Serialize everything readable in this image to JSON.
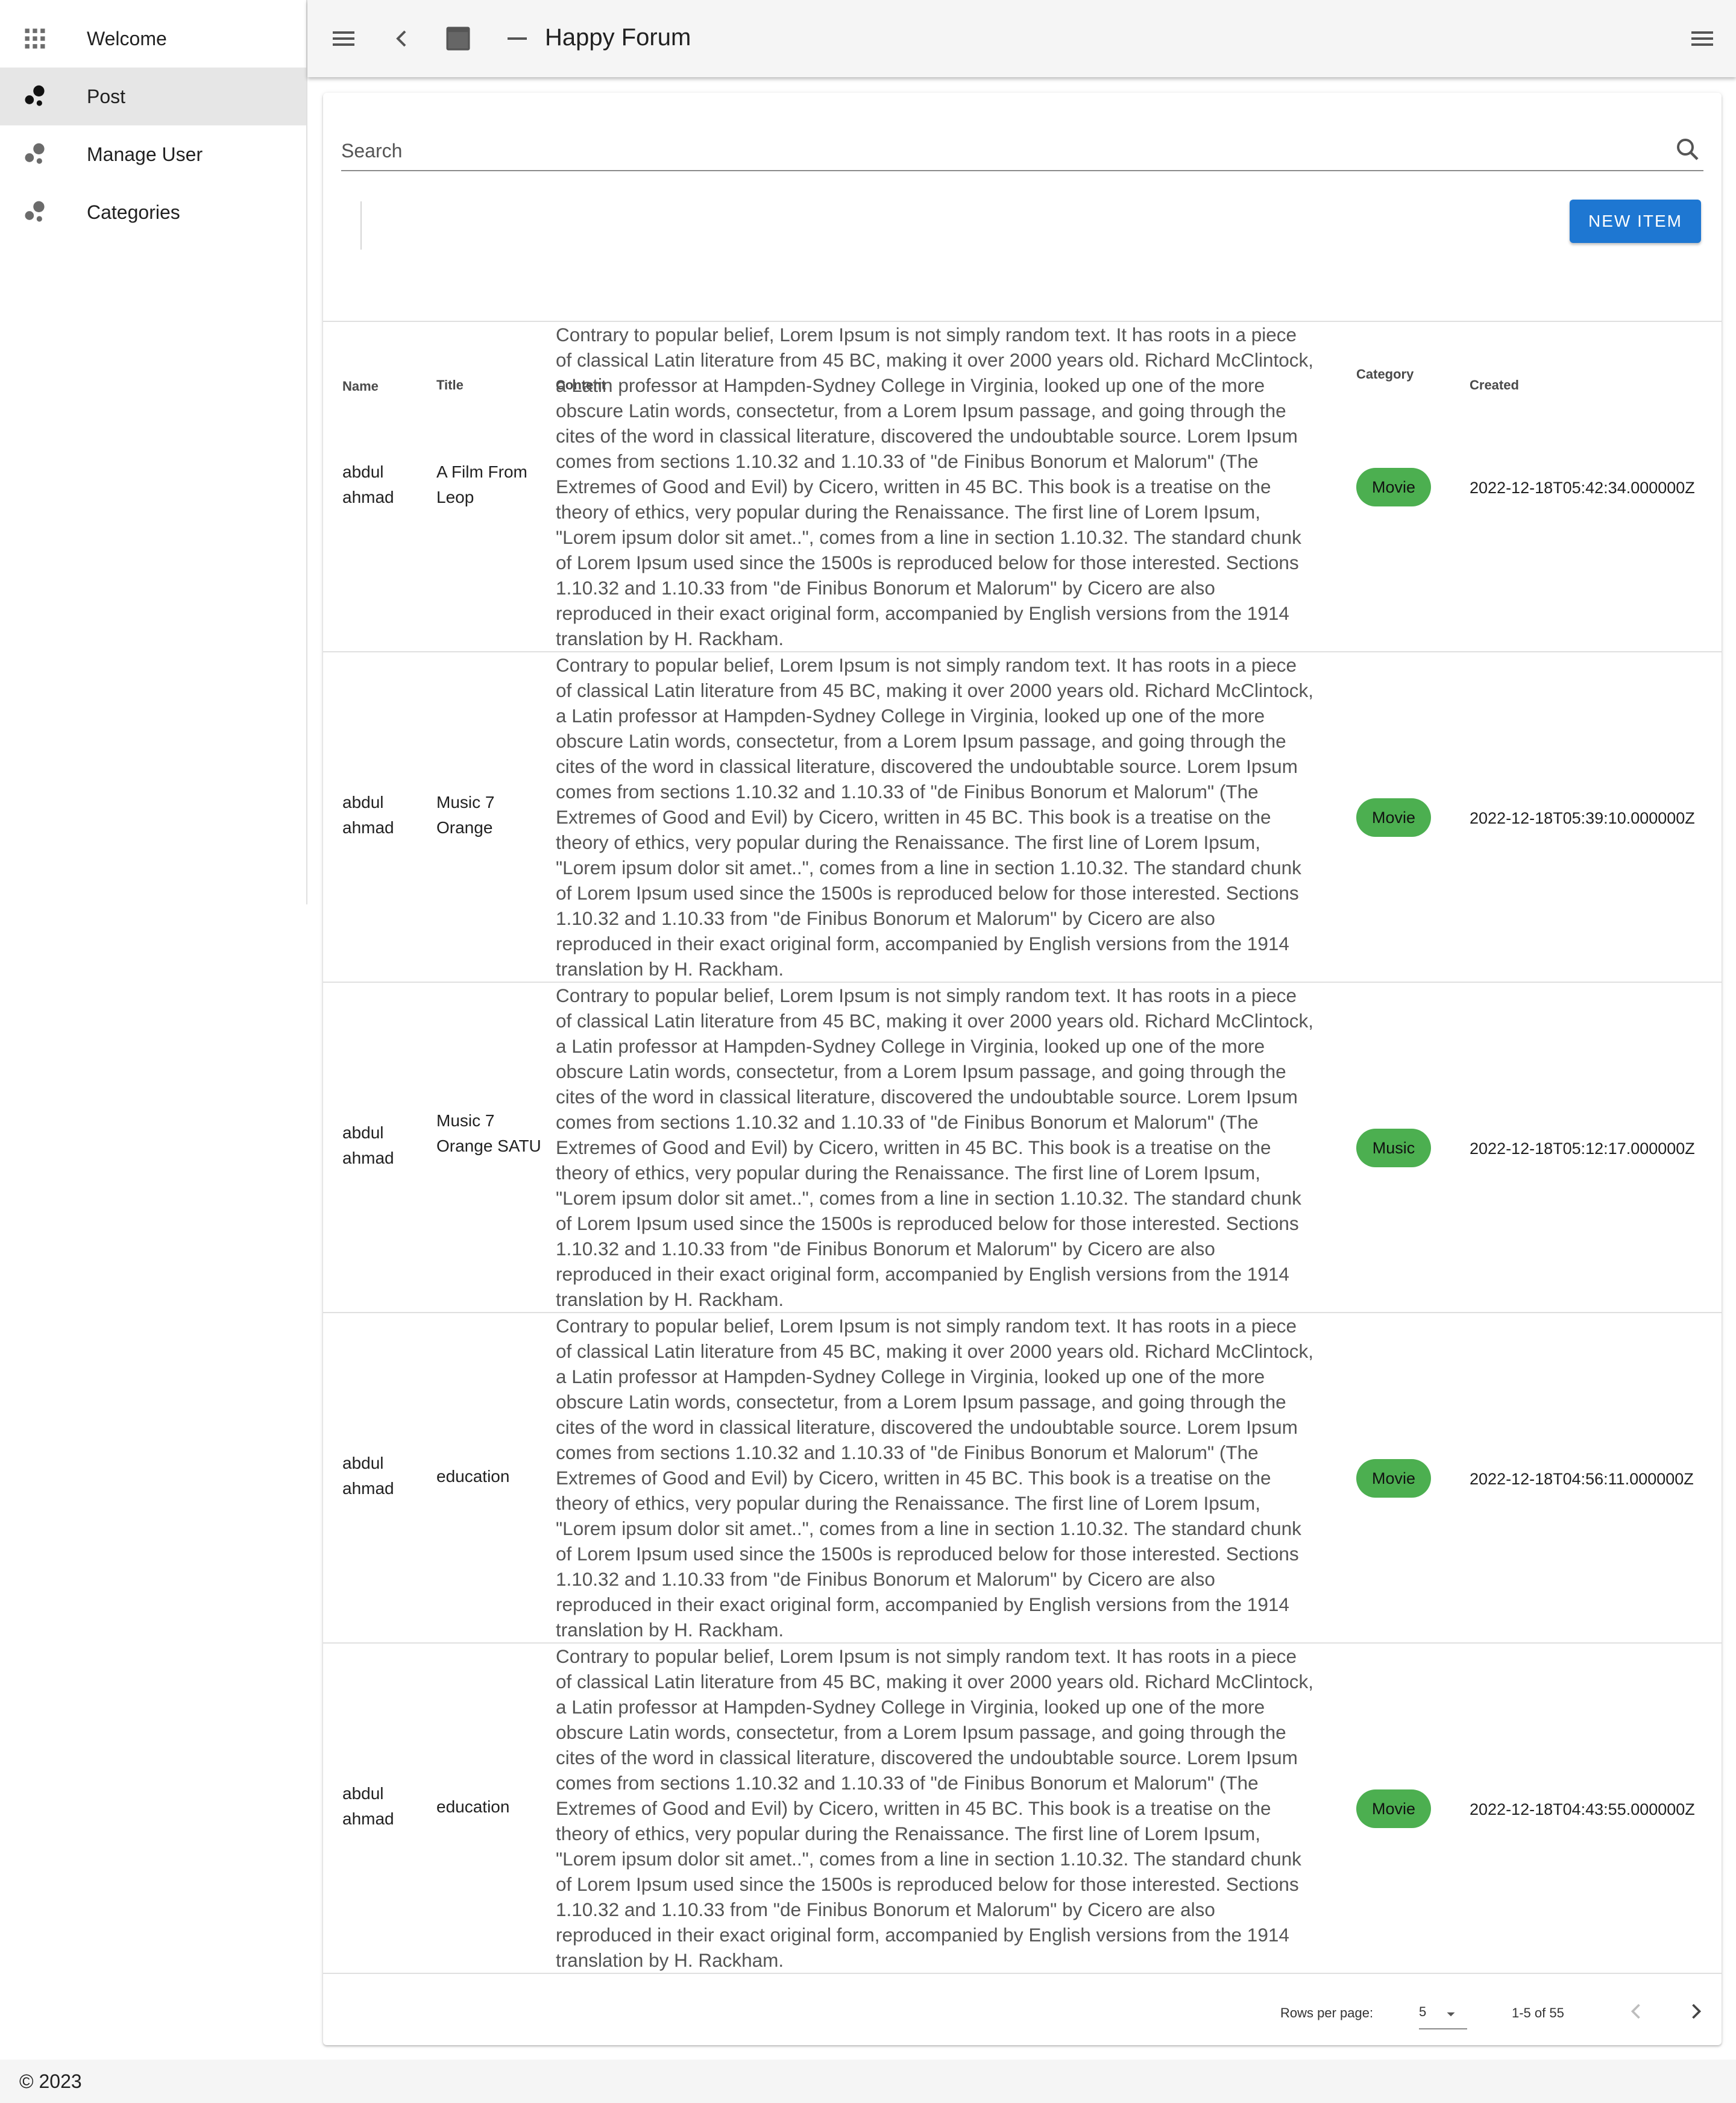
{
  "sidebar": {
    "items": [
      {
        "label": "Welcome",
        "icon": "apps-grid-icon"
      },
      {
        "label": "Post",
        "icon": "bubble-chart-icon"
      },
      {
        "label": "Manage User",
        "icon": "bubble-chart-icon"
      },
      {
        "label": "Categories",
        "icon": "bubble-chart-icon"
      }
    ],
    "active_index": 1
  },
  "header": {
    "title": "Happy Forum",
    "icons": [
      "menu-icon",
      "chevron-left-icon",
      "window-icon",
      "minimize-icon",
      "menu-icon"
    ]
  },
  "search": {
    "placeholder": "Search"
  },
  "toolbar": {
    "new_item_label": "NEW ITEM"
  },
  "table": {
    "columns": [
      "Name",
      "Title",
      "Content",
      "Category",
      "Created"
    ],
    "rows": [
      {
        "name": "abdul ahmad",
        "title": "A Film From Leop",
        "content": "Contrary to popular belief, Lorem Ipsum is not simply random text. It has roots in a piece of classical Latin literature from 45 BC, making it over 2000 years old. Richard McClintock, a Latin professor at Hampden-Sydney College in Virginia, looked up one of the more obscure Latin words, consectetur, from a Lorem Ipsum passage, and going through the cites of the word in classical literature, discovered the undoubtable source. Lorem Ipsum comes from sections 1.10.32 and 1.10.33 of \"de Finibus Bonorum et Malorum\" (The Extremes of Good and Evil) by Cicero, written in 45 BC. This book is a treatise on the theory of ethics, very popular during the Renaissance. The first line of Lorem Ipsum, \"Lorem ipsum dolor sit amet..\", comes from a line in section 1.10.32. The standard chunk of Lorem Ipsum used since the 1500s is reproduced below for those interested. Sections 1.10.32 and 1.10.33 from \"de Finibus Bonorum et Malorum\" by Cicero are also reproduced in their exact original form, accompanied by English versions from the 1914 translation by H. Rackham.",
        "category": "Movie",
        "created": "2022-12-18T05:42:34.000000Z"
      },
      {
        "name": "abdul ahmad",
        "title": "Music 7 Orange",
        "content": "Contrary to popular belief, Lorem Ipsum is not simply random text. It has roots in a piece of classical Latin literature from 45 BC, making it over 2000 years old. Richard McClintock, a Latin professor at Hampden-Sydney College in Virginia, looked up one of the more obscure Latin words, consectetur, from a Lorem Ipsum passage, and going through the cites of the word in classical literature, discovered the undoubtable source. Lorem Ipsum comes from sections 1.10.32 and 1.10.33 of \"de Finibus Bonorum et Malorum\" (The Extremes of Good and Evil) by Cicero, written in 45 BC. This book is a treatise on the theory of ethics, very popular during the Renaissance. The first line of Lorem Ipsum, \"Lorem ipsum dolor sit amet..\", comes from a line in section 1.10.32. The standard chunk of Lorem Ipsum used since the 1500s is reproduced below for those interested. Sections 1.10.32 and 1.10.33 from \"de Finibus Bonorum et Malorum\" by Cicero are also reproduced in their exact original form, accompanied by English versions from the 1914 translation by H. Rackham.",
        "category": "Movie",
        "created": "2022-12-18T05:39:10.000000Z"
      },
      {
        "name": "abdul ahmad",
        "title": "Music 7 Orange SATU",
        "content": "Contrary to popular belief, Lorem Ipsum is not simply random text. It has roots in a piece of classical Latin literature from 45 BC, making it over 2000 years old. Richard McClintock, a Latin professor at Hampden-Sydney College in Virginia, looked up one of the more obscure Latin words, consectetur, from a Lorem Ipsum passage, and going through the cites of the word in classical literature, discovered the undoubtable source. Lorem Ipsum comes from sections 1.10.32 and 1.10.33 of \"de Finibus Bonorum et Malorum\" (The Extremes of Good and Evil) by Cicero, written in 45 BC. This book is a treatise on the theory of ethics, very popular during the Renaissance. The first line of Lorem Ipsum, \"Lorem ipsum dolor sit amet..\", comes from a line in section 1.10.32. The standard chunk of Lorem Ipsum used since the 1500s is reproduced below for those interested. Sections 1.10.32 and 1.10.33 from \"de Finibus Bonorum et Malorum\" by Cicero are also reproduced in their exact original form, accompanied by English versions from the 1914 translation by H. Rackham.",
        "category": "Music",
        "created": "2022-12-18T05:12:17.000000Z"
      },
      {
        "name": "abdul ahmad",
        "title": "education",
        "content": "Contrary to popular belief, Lorem Ipsum is not simply random text. It has roots in a piece of classical Latin literature from 45 BC, making it over 2000 years old. Richard McClintock, a Latin professor at Hampden-Sydney College in Virginia, looked up one of the more obscure Latin words, consectetur, from a Lorem Ipsum passage, and going through the cites of the word in classical literature, discovered the undoubtable source. Lorem Ipsum comes from sections 1.10.32 and 1.10.33 of \"de Finibus Bonorum et Malorum\" (The Extremes of Good and Evil) by Cicero, written in 45 BC. This book is a treatise on the theory of ethics, very popular during the Renaissance. The first line of Lorem Ipsum, \"Lorem ipsum dolor sit amet..\", comes from a line in section 1.10.32. The standard chunk of Lorem Ipsum used since the 1500s is reproduced below for those interested. Sections 1.10.32 and 1.10.33 from \"de Finibus Bonorum et Malorum\" by Cicero are also reproduced in their exact original form, accompanied by English versions from the 1914 translation by H. Rackham.",
        "category": "Movie",
        "created": "2022-12-18T04:56:11.000000Z"
      },
      {
        "name": "abdul ahmad",
        "title": "education",
        "content": "Contrary to popular belief, Lorem Ipsum is not simply random text. It has roots in a piece of classical Latin literature from 45 BC, making it over 2000 years old. Richard McClintock, a Latin professor at Hampden-Sydney College in Virginia, looked up one of the more obscure Latin words, consectetur, from a Lorem Ipsum passage, and going through the cites of the word in classical literature, discovered the undoubtable source. Lorem Ipsum comes from sections 1.10.32 and 1.10.33 of \"de Finibus Bonorum et Malorum\" (The Extremes of Good and Evil) by Cicero, written in 45 BC. This book is a treatise on the theory of ethics, very popular during the Renaissance. The first line of Lorem Ipsum, \"Lorem ipsum dolor sit amet..\", comes from a line in section 1.10.32. The standard chunk of Lorem Ipsum used since the 1500s is reproduced below for those interested. Sections 1.10.32 and 1.10.33 from \"de Finibus Bonorum et Malorum\" by Cicero are also reproduced in their exact original form, accompanied by English versions from the 1914 translation by H. Rackham.",
        "category": "Movie",
        "created": "2022-12-18T04:43:55.000000Z"
      }
    ]
  },
  "pagination": {
    "rows_per_page_label": "Rows per page:",
    "rows_per_page": "5",
    "range": "1-5 of 55"
  },
  "footer": {
    "copyright": "© 2023"
  },
  "colors": {
    "primary": "#1e77d2",
    "chip": "#4caf50",
    "topbar": "#f5f5f5",
    "active_nav": "#e6e6e6"
  }
}
